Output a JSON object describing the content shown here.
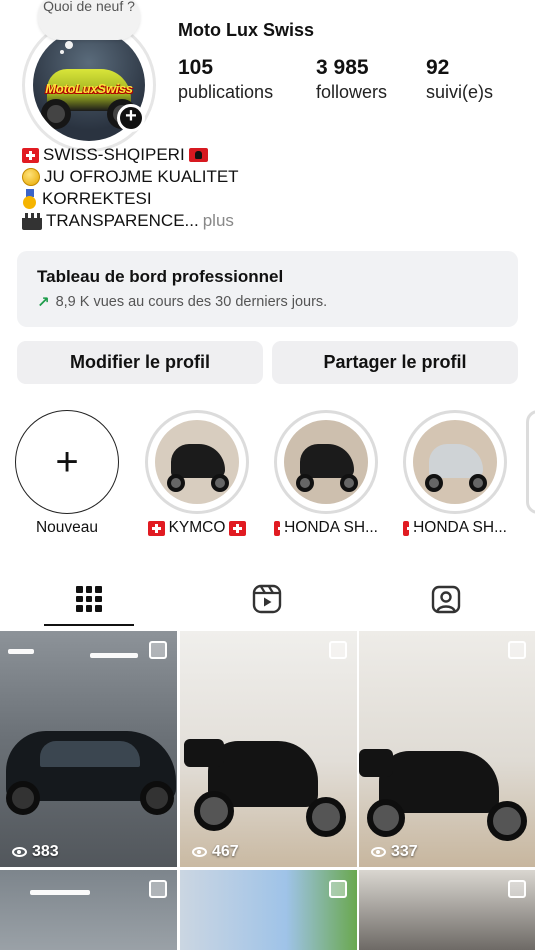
{
  "profile": {
    "note": "Quoi de neuf ?",
    "avatar_text": "MotoLuxSwiss",
    "username": "Moto Lux Swiss",
    "stats": [
      {
        "value": "105",
        "label": "publications"
      },
      {
        "value": "3 985",
        "label": "followers"
      },
      {
        "value": "92",
        "label": "suivi(e)s"
      }
    ]
  },
  "bio": {
    "line1": "SWISS-SHQIPERI",
    "line2": "JU OFROJME KUALITET",
    "line3": "KORREKTESI",
    "line4": "TRANSPARENCE...",
    "more": "plus"
  },
  "dashboard": {
    "title": "Tableau de bord professionnel",
    "subtitle": "8,9 K vues au cours des 30 derniers jours."
  },
  "buttons": {
    "edit": "Modifier le profil",
    "share": "Partager le profil"
  },
  "highlights": [
    {
      "label": "Nouveau"
    },
    {
      "label": "KYMCO"
    },
    {
      "label": "HONDA SH..."
    },
    {
      "label": "HONDA SH..."
    }
  ],
  "tabs": [
    "grid-icon",
    "reels-icon",
    "tagged-icon"
  ],
  "posts": [
    {
      "views": "383"
    },
    {
      "views": "467"
    },
    {
      "views": "337"
    }
  ],
  "colors": {
    "dashboard_bg": "#f1f2f4",
    "button_bg": "#efeff1",
    "trend": "#1d9c4a",
    "muted": "#888888"
  }
}
